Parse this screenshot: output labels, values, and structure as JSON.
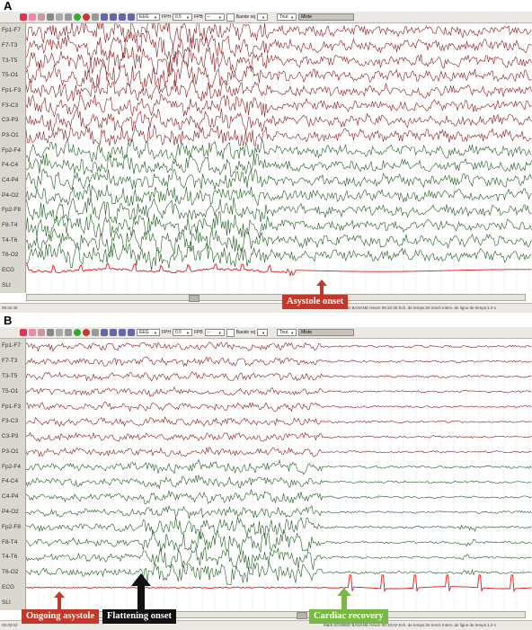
{
  "colors": {
    "left_channels": "#8b1a1a",
    "right_channels": "#1d5c1d",
    "ecg": "#e01e1e",
    "annotation_red": "#c0392b",
    "annotation_black": "#111111",
    "annotation_green": "#79b844"
  },
  "channels": [
    "Fp1-F7",
    "F7-T3",
    "T3-T5",
    "T5-O1",
    "Fp1-F3",
    "F3-C3",
    "C3-P3",
    "P3-O1",
    "Fp2-F4",
    "F4-C4",
    "C4-P4",
    "P4-O2",
    "Fp2-F8",
    "F8-T4",
    "T4-T6",
    "T6-O2",
    "ECG",
    "SLI"
  ],
  "toolbar": {
    "montage_type": "EEG",
    "fph_label": "FPH",
    "fph_value": "0.5",
    "fpb_label": "FPB",
    "fpb_value": "--",
    "band_label": "Bande rej",
    "scope": "Tout",
    "montage": "Mixte"
  },
  "panels": [
    {
      "label": "A",
      "status_time": "09:32:45",
      "status_info": "Mark SOOBEE BANANE Heure 09:32:45 Ech. de temps:20 mm/s Interv. de ligne de temps:1.0 s",
      "annotations": [
        {
          "text": "Asystole onset",
          "style": "red"
        }
      ]
    },
    {
      "label": "B",
      "status_time": "09:33:02",
      "status_info": "Mark SOOBEE BANANE Heure 09:33:02 Ech. de temps:20 mm/s Interv. de ligne de temps:1.0 s",
      "annotations": [
        {
          "text": "Ongoing asystole",
          "style": "red"
        },
        {
          "text": "Flattening onset",
          "style": "black"
        },
        {
          "text": "Cardiac recovery",
          "style": "green"
        }
      ]
    }
  ],
  "icons": [
    "scissors-icon",
    "undo-icon",
    "redo-icon",
    "home-icon",
    "search-icon",
    "zoom-icon",
    "play-icon",
    "stop-icon",
    "record-icon",
    "filter-icon",
    "montage-icon",
    "print-icon"
  ]
}
